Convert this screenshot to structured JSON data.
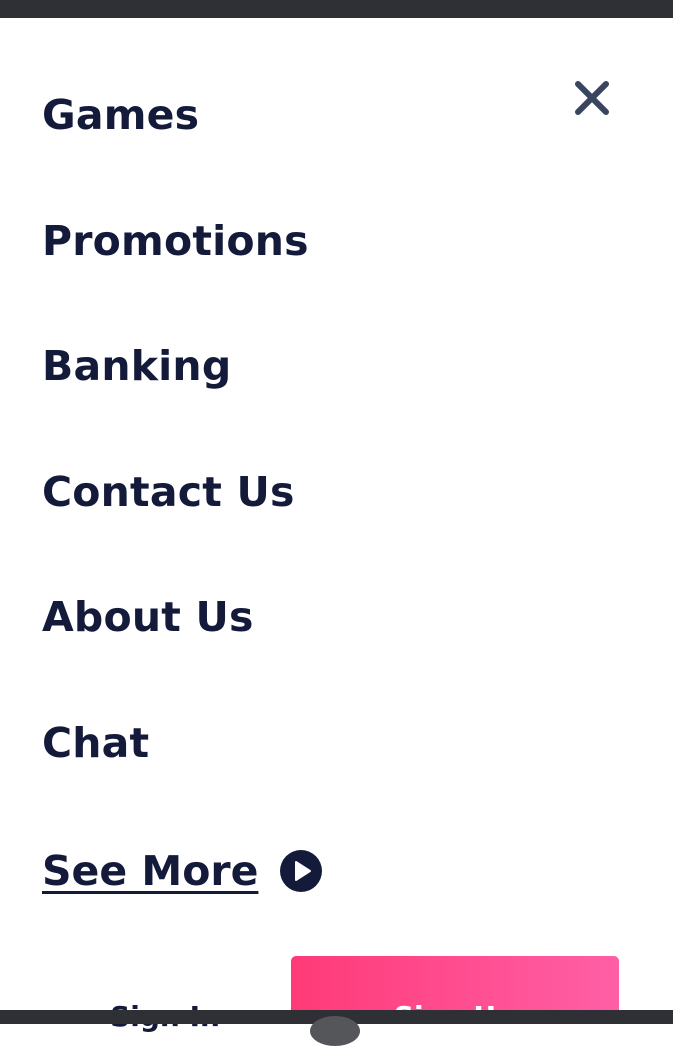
{
  "menu": {
    "items": [
      {
        "label": "Games"
      },
      {
        "label": "Promotions"
      },
      {
        "label": "Banking"
      },
      {
        "label": "Contact Us"
      },
      {
        "label": "About Us"
      },
      {
        "label": "Chat"
      }
    ],
    "see_more_label": "See More",
    "close_icon": "close-icon",
    "see_more_icon": "play-circle-icon"
  },
  "actions": {
    "sign_in_label": "Sign In",
    "sign_up_label": "Sign Up"
  },
  "colors": {
    "text": "#131a3a",
    "close_icon": "#3a4560",
    "accent_gradient_start": "#ff3a78",
    "accent_gradient_end": "#ff5fa6",
    "system_bar": "#2f3035"
  }
}
